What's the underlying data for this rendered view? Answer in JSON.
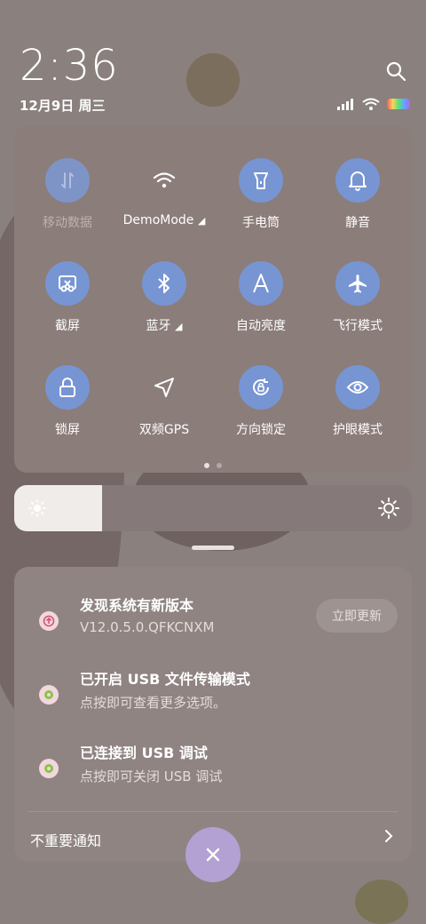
{
  "status": {
    "time": "2:36",
    "date": "12月9日 周三"
  },
  "quick_tiles": [
    {
      "label": "移动数据",
      "icon": "mobile-data-icon"
    },
    {
      "label": "DemoMode",
      "icon": "wifi-icon"
    },
    {
      "label": "手电筒",
      "icon": "flashlight-icon"
    },
    {
      "label": "静音",
      "icon": "bell-icon"
    },
    {
      "label": "截屏",
      "icon": "screenshot-icon"
    },
    {
      "label": "蓝牙",
      "icon": "bluetooth-icon"
    },
    {
      "label": "自动亮度",
      "icon": "auto-brightness-icon"
    },
    {
      "label": "飞行模式",
      "icon": "airplane-icon"
    },
    {
      "label": "锁屏",
      "icon": "lock-icon"
    },
    {
      "label": "双频GPS",
      "icon": "gps-icon"
    },
    {
      "label": "方向锁定",
      "icon": "rotation-lock-icon"
    },
    {
      "label": "护眼模式",
      "icon": "eye-icon"
    }
  ],
  "brightness": {
    "level": 0.22
  },
  "notifications": [
    {
      "title": "发现系统有新版本",
      "subtitle": "V12.0.5.0.QFKCNXM",
      "action": "立即更新"
    },
    {
      "title": "已开启 USB 文件传输模式",
      "subtitle": "点按即可查看更多选项。"
    },
    {
      "title": "已连接到 USB 调试",
      "subtitle": "点按即可关闭 USB 调试"
    }
  ],
  "unimportant_label": "不重要通知",
  "colors": {
    "accent": "#7795d3",
    "fab": "#b2a1d2"
  }
}
